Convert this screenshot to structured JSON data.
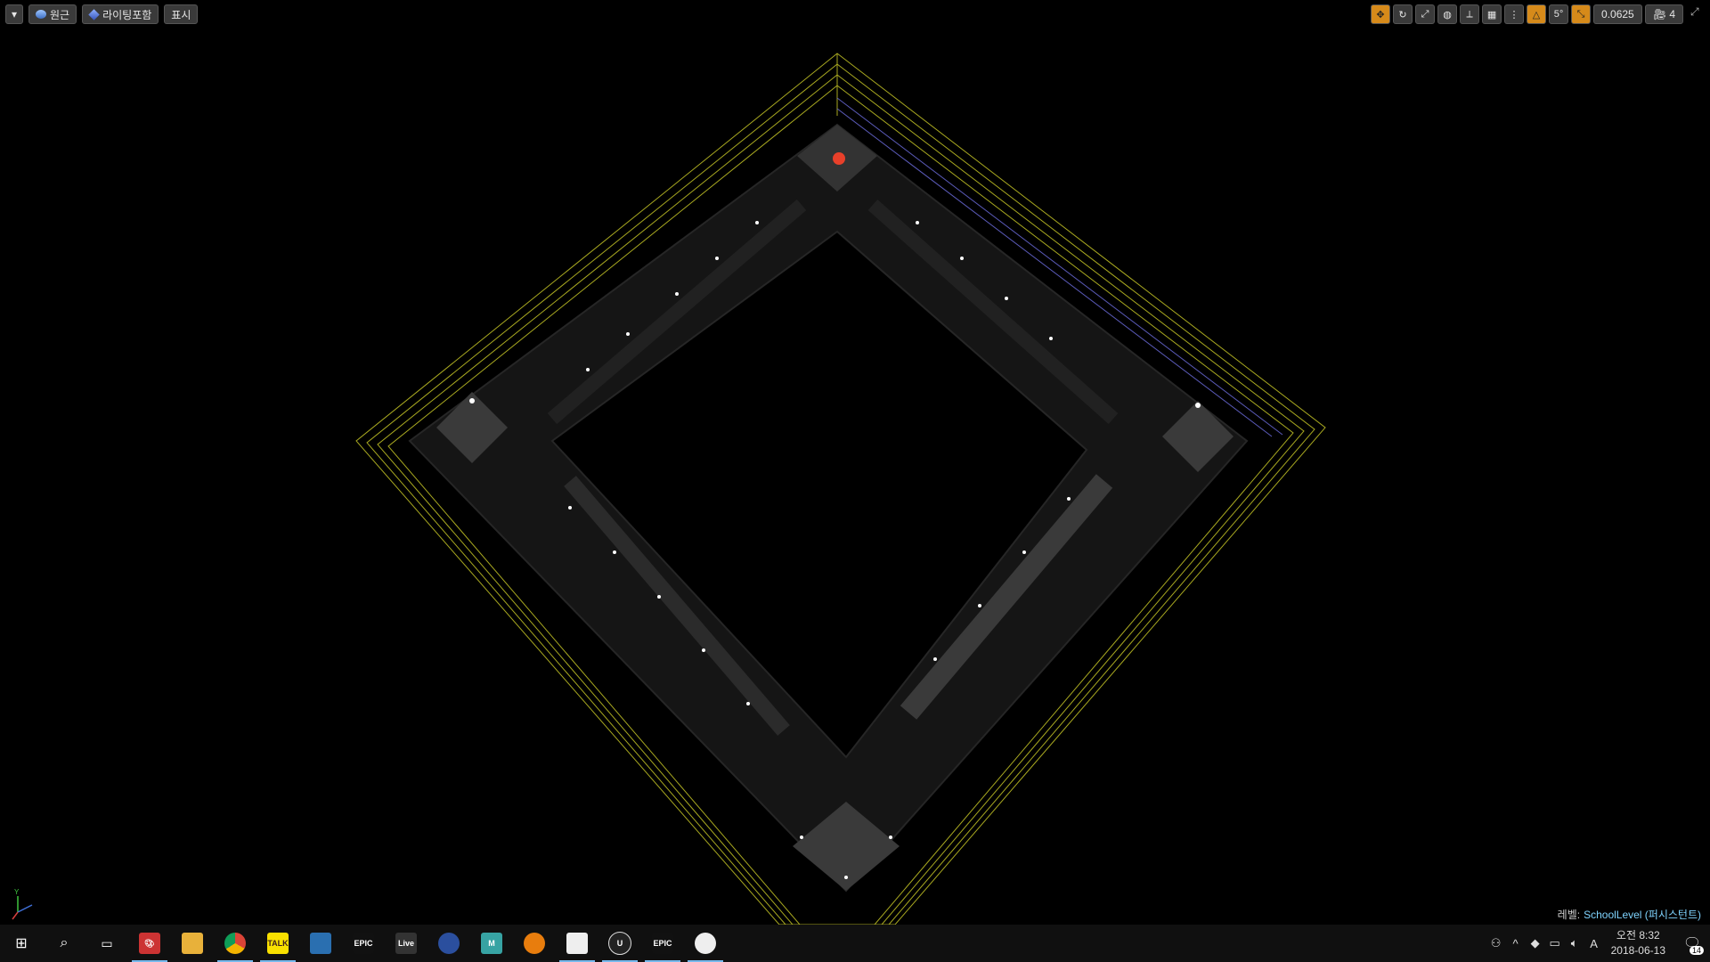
{
  "toolbar_left": {
    "dropdown_icon": "chevron-down-icon",
    "perspective_label": "원근",
    "lighting_label": "라이팅포함",
    "show_label": "표시"
  },
  "toolbar_right": {
    "snap_value": "0.0625",
    "rotation_snap": "5°",
    "camera_speed": "4",
    "accent_color": "#d68a1a"
  },
  "level": {
    "prefix": "레벨:",
    "name": "SchoolLevel (퍼시스턴트)"
  },
  "taskbar": {
    "apps": [
      {
        "name": "start-icon",
        "label": ""
      },
      {
        "name": "search-icon",
        "label": ""
      },
      {
        "name": "task-view-icon",
        "label": ""
      },
      {
        "name": "paint-icon",
        "label": ""
      },
      {
        "name": "file-explorer-icon",
        "label": ""
      },
      {
        "name": "chrome-icon",
        "label": ""
      },
      {
        "name": "kakaotalk-icon",
        "label": "TALK"
      },
      {
        "name": "app-icon",
        "label": ""
      },
      {
        "name": "epic-games-icon",
        "label": "EPIC"
      },
      {
        "name": "ableton-live-icon",
        "label": "Live"
      },
      {
        "name": "cinema4d-icon",
        "label": ""
      },
      {
        "name": "maya-icon",
        "label": "M"
      },
      {
        "name": "blender-icon",
        "label": ""
      },
      {
        "name": "sticky-notes-icon",
        "label": ""
      },
      {
        "name": "unreal-engine-icon",
        "label": "U"
      },
      {
        "name": "epic-games-launcher-icon",
        "label": "EPIC"
      },
      {
        "name": "obs-icon",
        "label": ""
      }
    ],
    "ime_indicator": "A",
    "time": "오전 8:32",
    "date": "2018-06-13",
    "notifications": "14"
  }
}
